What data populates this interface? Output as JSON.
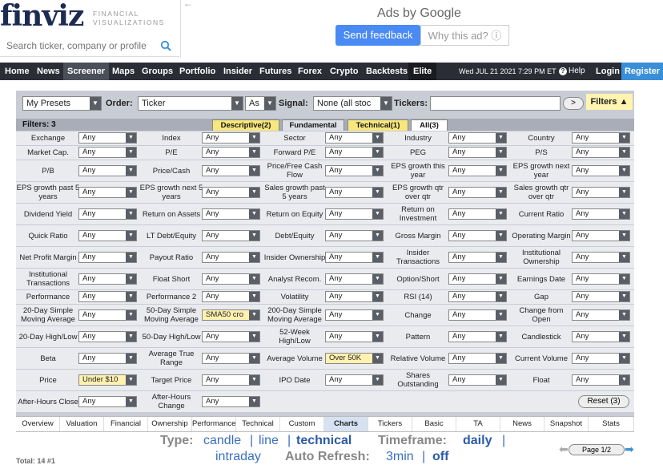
{
  "logo": {
    "text": "finviz",
    "sub1": "FINANCIAL",
    "sub2": "VISUALIZATIONS"
  },
  "search": {
    "placeholder": "Search ticker, company or profile"
  },
  "ad": {
    "back": "←",
    "title": "Ads by Google",
    "feedback": "Send feedback",
    "why": "Why this ad? ⓘ"
  },
  "nav": {
    "items": [
      "Home",
      "News",
      "Screener",
      "Maps",
      "Groups",
      "Portfolio",
      "Insider",
      "Futures",
      "Forex",
      "Crypto",
      "Backtests",
      "Elite"
    ],
    "date": "Wed JUL 21 2021 7:29 PM ET",
    "help": "Help",
    "login": "Login",
    "register": "Register"
  },
  "controls": {
    "presets": "My Presets",
    "order_label": "Order:",
    "order_value": "Ticker",
    "order_dir": "As",
    "signal_label": "Signal:",
    "signal_value": "None (all stoc",
    "tickers_label": "Tickers:",
    "go": ">",
    "filters_btn": "Filters ▲"
  },
  "filters": {
    "count_label": "Filters: 3",
    "tabs": [
      "Descriptive(2)",
      "Fundamental",
      "Technical(1)",
      "All(3)"
    ]
  },
  "grid": [
    [
      "Exchange",
      "Any",
      "Index",
      "Any",
      "Sector",
      "Any",
      "Industry",
      "Any",
      "Country",
      "Any"
    ],
    [
      "Market Cap.",
      "Any",
      "P/E",
      "Any",
      "Forward P/E",
      "Any",
      "PEG",
      "Any",
      "P/S",
      "Any"
    ],
    [
      "P/B",
      "Any",
      "Price/Cash",
      "Any",
      "Price/Free Cash Flow",
      "Any",
      "EPS growth this year",
      "Any",
      "EPS growth next year",
      "Any"
    ],
    [
      "EPS growth past 5 years",
      "Any",
      "EPS growth next 5 years",
      "Any",
      "Sales growth past 5 years",
      "Any",
      "EPS growth qtr over qtr",
      "Any",
      "Sales growth qtr over qtr",
      "Any"
    ],
    [
      "Dividend Yield",
      "Any",
      "Return on Assets",
      "Any",
      "Return on Equity",
      "Any",
      "Return on Investment",
      "Any",
      "Current Ratio",
      "Any"
    ],
    [
      "Quick Ratio",
      "Any",
      "LT Debt/Equity",
      "Any",
      "Debt/Equity",
      "Any",
      "Gross Margin",
      "Any",
      "Operating Margin",
      "Any"
    ],
    [
      "Net Profit Margin",
      "Any",
      "Payout Ratio",
      "Any",
      "Insider Ownership",
      "Any",
      "Insider Transactions",
      "Any",
      "Institutional Ownership",
      "Any"
    ],
    [
      "Institutional Transactions",
      "Any",
      "Float Short",
      "Any",
      "Analyst Recom.",
      "Any",
      "Option/Short",
      "Any",
      "Earnings Date",
      "Any"
    ],
    [
      "Performance",
      "Any",
      "Performance 2",
      "Any",
      "Volatility",
      "Any",
      "RSI (14)",
      "Any",
      "Gap",
      "Any"
    ],
    [
      "20-Day Simple Moving Average",
      "Any",
      "50-Day Simple Moving Average",
      "SMA50 cro",
      "200-Day Simple Moving Average",
      "Any",
      "Change",
      "Any",
      "Change from Open",
      "Any"
    ],
    [
      "20-Day High/Low",
      "Any",
      "50-Day High/Low",
      "Any",
      "52-Week High/Low",
      "Any",
      "Pattern",
      "Any",
      "Candlestick",
      "Any"
    ],
    [
      "Beta",
      "Any",
      "Average True Range",
      "Any",
      "Average Volume",
      "Over 50K",
      "Relative Volume",
      "Any",
      "Current Volume",
      "Any"
    ],
    [
      "Price",
      "Under $10",
      "Target Price",
      "Any",
      "IPO Date",
      "Any",
      "Shares Outstanding",
      "Any",
      "Float",
      "Any"
    ],
    [
      "After-Hours Close",
      "Any",
      "After-Hours Change",
      "Any"
    ]
  ],
  "reset": "Reset (3)",
  "view_tabs": [
    "Overview",
    "Valuation",
    "Financial",
    "Ownership",
    "Performance",
    "Technical",
    "Custom",
    "Charts",
    "Tickers",
    "Basic",
    "TA",
    "News",
    "Snapshot",
    "Stats"
  ],
  "bottom": {
    "type_label": "Type:",
    "type_opts": [
      "candle",
      "line",
      "technical"
    ],
    "timeframe_label": "Timeframe:",
    "tf_opts": [
      "daily",
      "intraday"
    ],
    "auto_label": "Auto Refresh:",
    "auto_opts": [
      "3min",
      "off"
    ],
    "sep": "|",
    "total": "Total: 14 #1",
    "page": "Page 1/2"
  }
}
